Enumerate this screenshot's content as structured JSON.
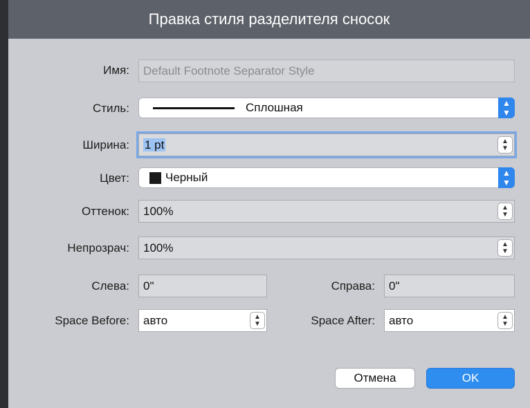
{
  "dialog": {
    "title": "Правка стиля разделителя сносок"
  },
  "fields": {
    "name": {
      "label": "Имя:",
      "value": "Default Footnote Separator Style"
    },
    "style": {
      "label": "Стиль:",
      "value": "Сплошная"
    },
    "width": {
      "label": "Ширина:",
      "value": "1 pt"
    },
    "color": {
      "label": "Цвет:",
      "value": "Черный",
      "swatch": "#1a1a1a"
    },
    "tint": {
      "label": "Оттенок:",
      "value": "100%"
    },
    "opacity": {
      "label": "Непрозрач:",
      "value": "100%"
    },
    "left": {
      "label": "Слева:",
      "value": "0\""
    },
    "right": {
      "label": "Справа:",
      "value": "0\""
    },
    "space_before": {
      "label": "Space Before:",
      "value": "авто"
    },
    "space_after": {
      "label": "Space After:",
      "value": "авто"
    }
  },
  "buttons": {
    "cancel": "Отмена",
    "ok": "OK"
  },
  "colors": {
    "accent": "#2f86ec",
    "titlebar": "#5d6169"
  }
}
